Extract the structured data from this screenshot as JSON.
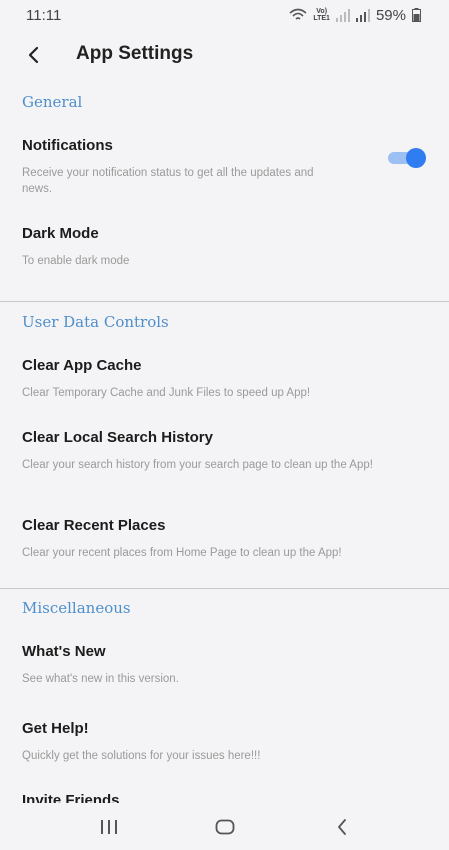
{
  "status": {
    "time": "11:11",
    "volte_top": "Vo)",
    "volte_bottom": "LTE1",
    "battery": "59%"
  },
  "header": {
    "title": "App Settings"
  },
  "sections": {
    "general": {
      "title": "General",
      "notifications": {
        "title": "Notifications",
        "desc": "Receive your notification status to get all the updates and news.",
        "toggle_on": true
      },
      "dark_mode": {
        "title": "Dark Mode",
        "desc": "To enable dark mode"
      }
    },
    "user_data": {
      "title": "User Data Controls",
      "clear_cache": {
        "title": "Clear App Cache",
        "desc": "Clear Temporary Cache and Junk Files to speed up App!"
      },
      "clear_search": {
        "title": "Clear Local Search History",
        "desc": "Clear your search history from your search page to clean up the App!"
      },
      "clear_places": {
        "title": "Clear Recent Places",
        "desc": "Clear your recent places from Home Page to clean up the App!"
      }
    },
    "misc": {
      "title": "Miscellaneous",
      "whats_new": {
        "title": "What's New",
        "desc": "See what's new in this version."
      },
      "get_help": {
        "title": "Get Help!",
        "desc": "Quickly get the solutions for your issues here!!!"
      },
      "invite": {
        "title": "Invite Friends"
      }
    }
  },
  "colors": {
    "accent": "#4e8fcb",
    "toggle": "#2f7df0",
    "background": "#f4f4f6"
  }
}
